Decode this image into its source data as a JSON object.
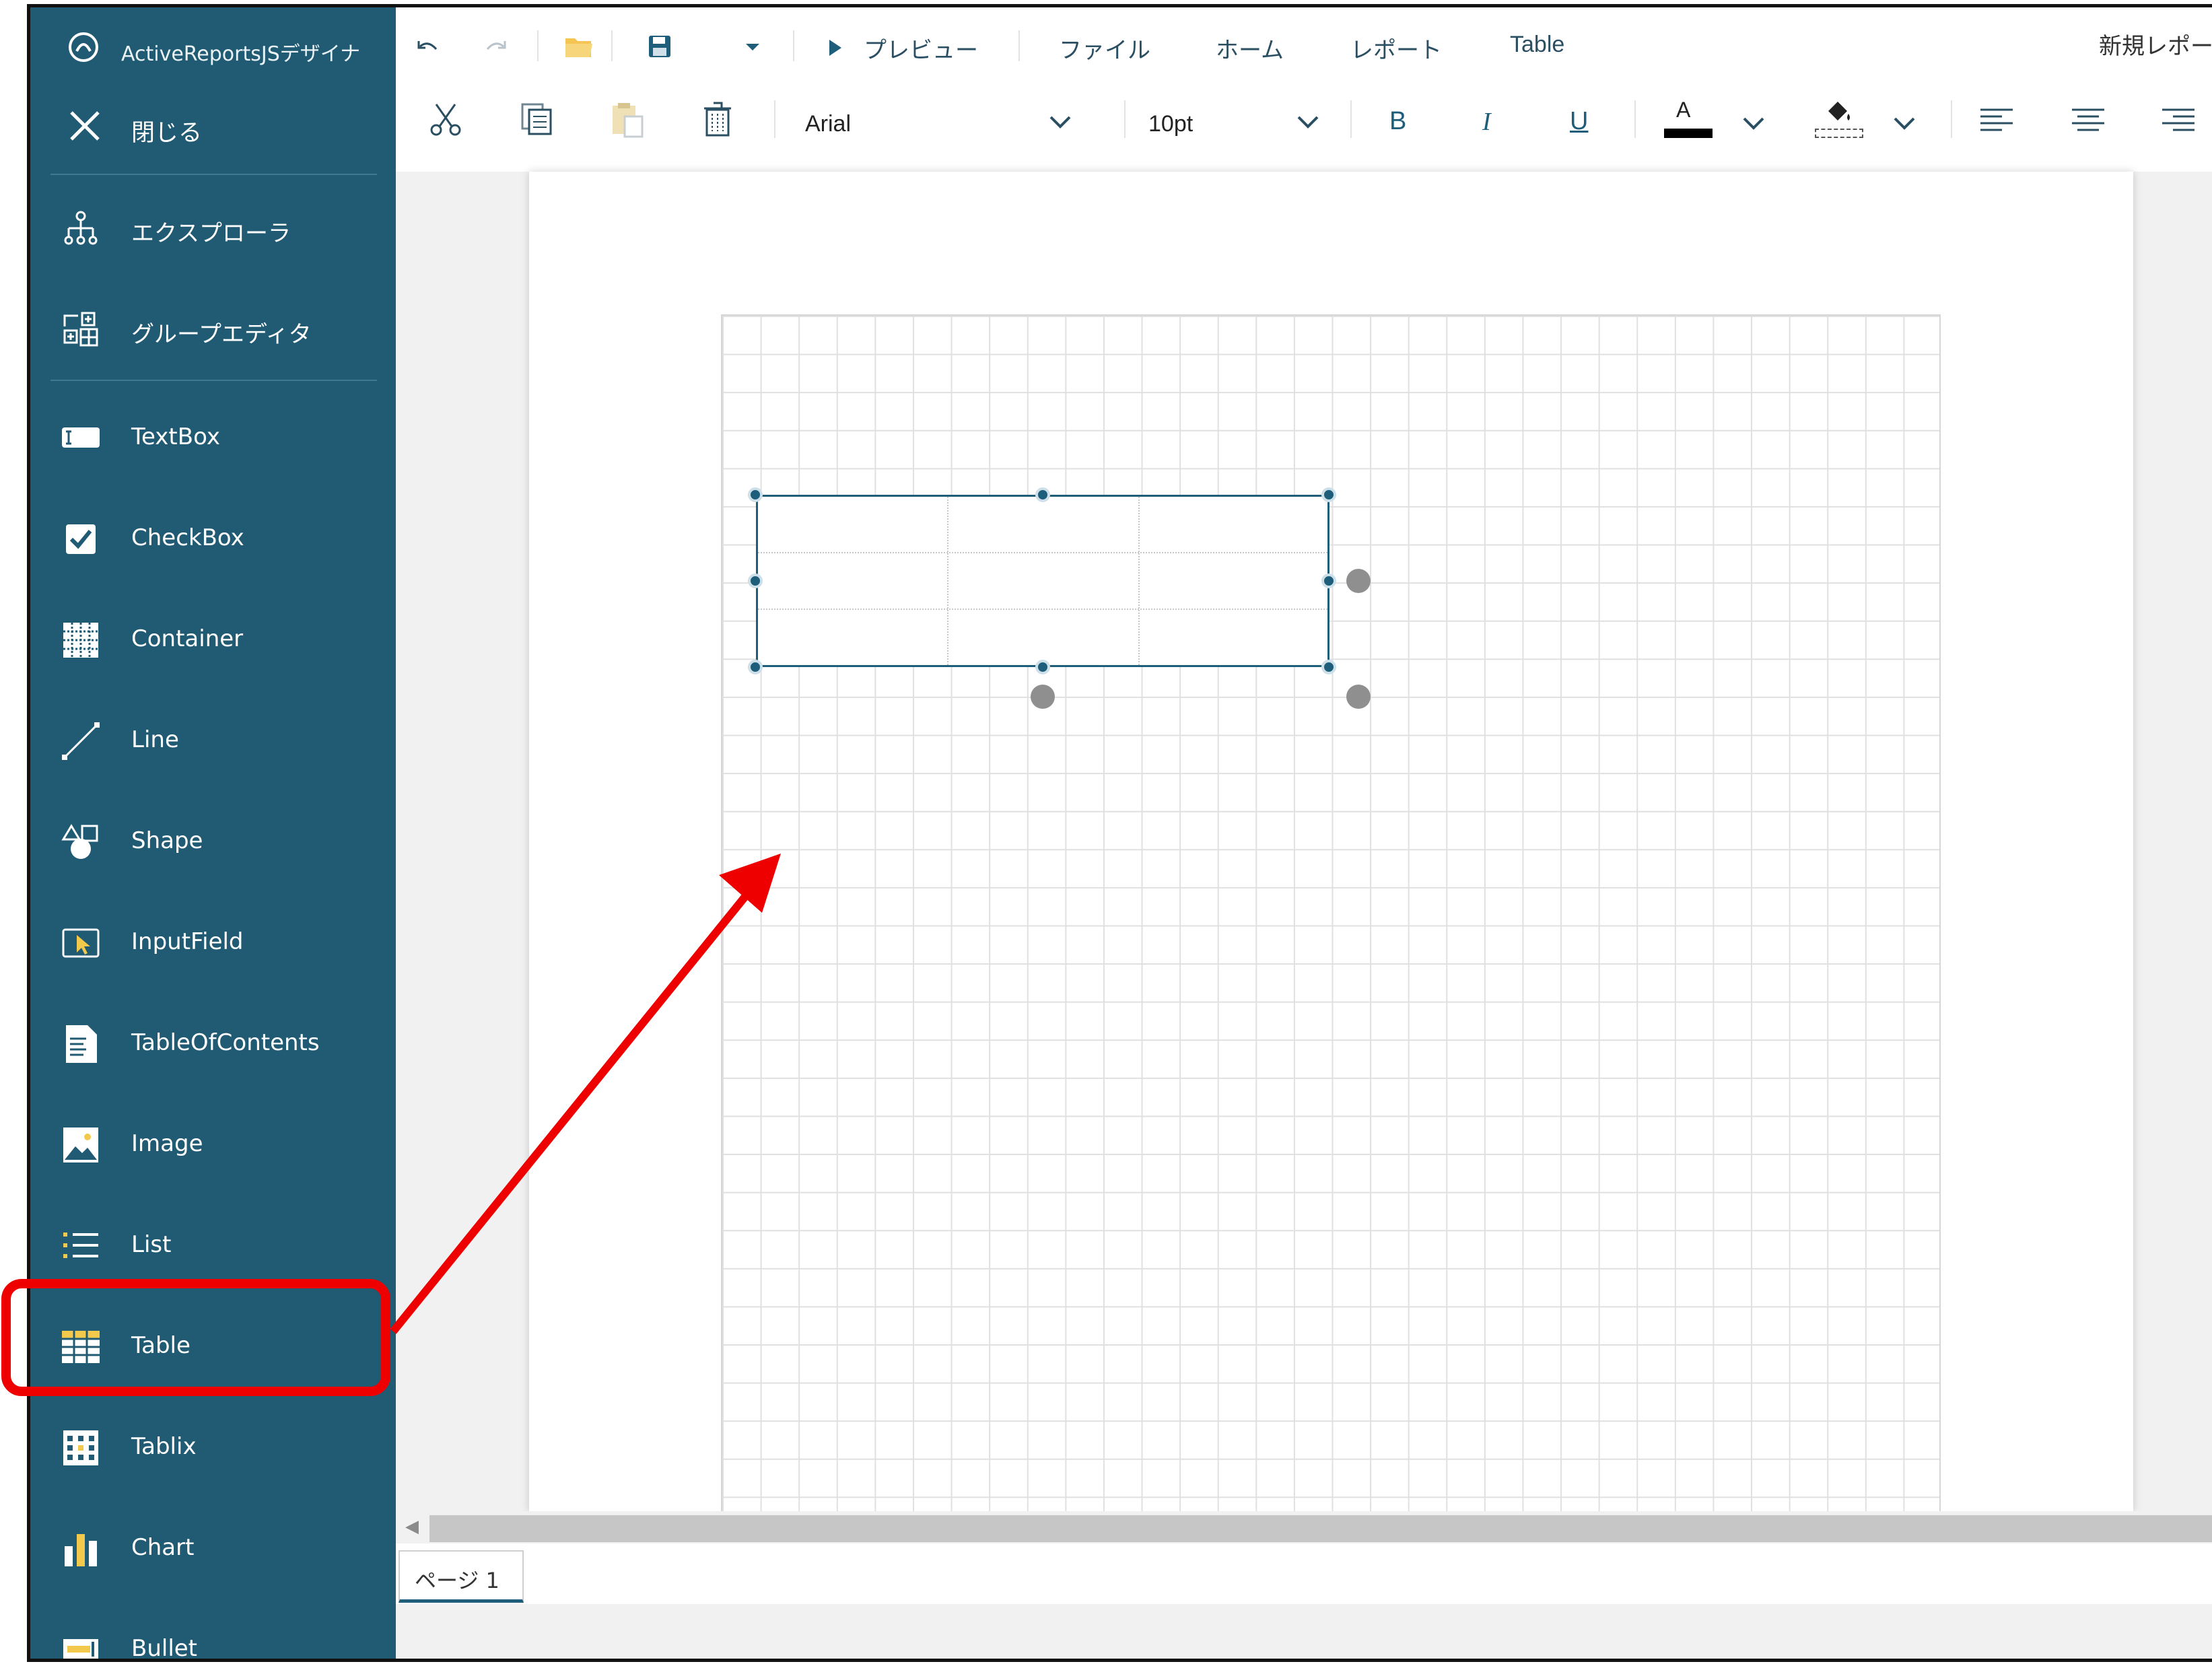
{
  "app": {
    "title": "ActiveReportsJSデザイナ",
    "report_name": "新規レポート"
  },
  "sidebar": {
    "close_label": "閉じる",
    "tools": [
      {
        "label": "エクスプローラ",
        "icon": "explorer-tree-icon"
      },
      {
        "label": "グループエディタ",
        "icon": "group-editor-icon"
      }
    ],
    "items": [
      {
        "label": "TextBox",
        "icon": "textbox-icon"
      },
      {
        "label": "CheckBox",
        "icon": "checkbox-icon"
      },
      {
        "label": "Container",
        "icon": "container-icon"
      },
      {
        "label": "Line",
        "icon": "line-icon"
      },
      {
        "label": "Shape",
        "icon": "shape-icon"
      },
      {
        "label": "InputField",
        "icon": "inputfield-icon"
      },
      {
        "label": "TableOfContents",
        "icon": "tableofcontents-icon"
      },
      {
        "label": "Image",
        "icon": "image-icon"
      },
      {
        "label": "List",
        "icon": "list-icon"
      },
      {
        "label": "Table",
        "icon": "table-icon"
      },
      {
        "label": "Tablix",
        "icon": "tablix-icon"
      },
      {
        "label": "Chart",
        "icon": "chart-icon"
      },
      {
        "label": "Bullet",
        "icon": "bullet-icon"
      }
    ],
    "highlighted_item": "Table"
  },
  "menu": {
    "preview": "プレビュー",
    "file": "ファイル",
    "home": "ホーム",
    "report": "レポート",
    "table": "Table"
  },
  "format": {
    "font_family": "Arial",
    "font_size": "10pt",
    "bold": "B",
    "italic": "I",
    "underline": "U",
    "font_color_letter": "A"
  },
  "tabs": {
    "page1": "ページ 1"
  },
  "colors": {
    "sidebar_bg": "#205b73",
    "accent": "#1f5e7a",
    "callout": "#ee0000",
    "font_color": "#000000"
  }
}
